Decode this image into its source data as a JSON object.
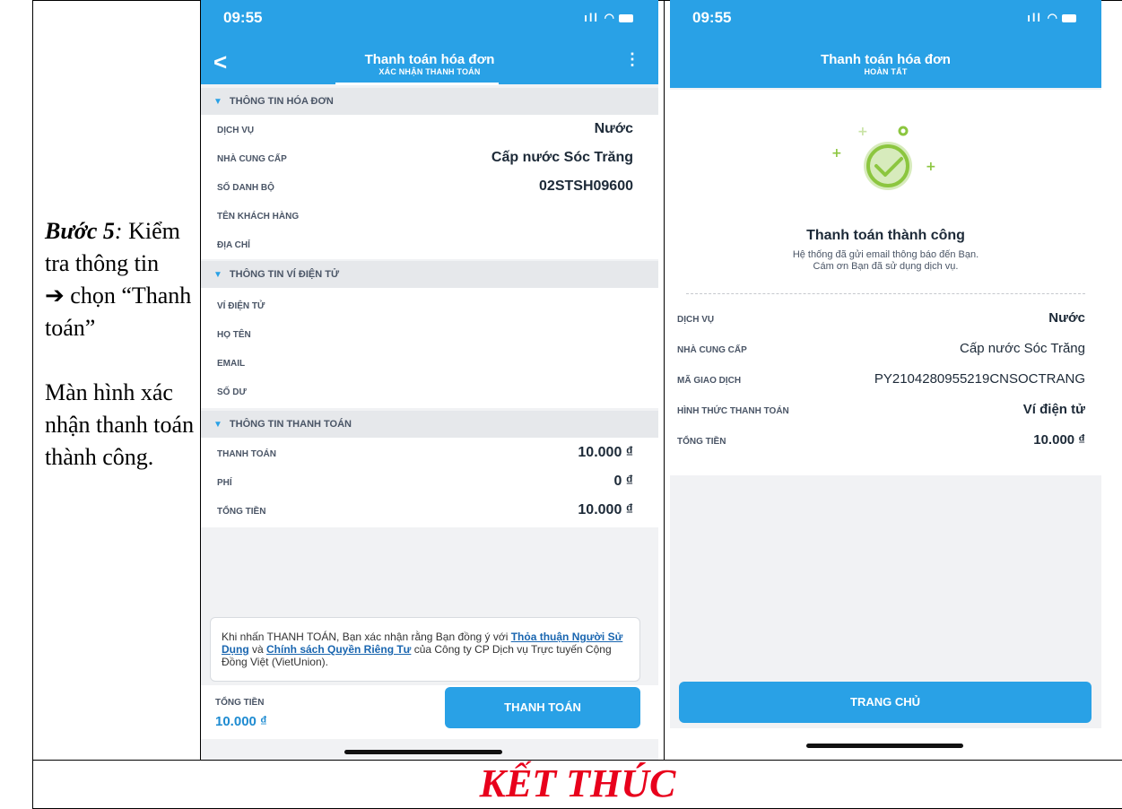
{
  "instruction": {
    "step_label": "Bước 5",
    "step_suffix": ":",
    "line1_tail": " Kiểm tra thông tin",
    "arrow": "➔",
    "line2_tail": " chọn “Thanh toán”",
    "para2": "Màn hình xác nhận thanh toán thành công."
  },
  "footer": {
    "title": "KẾT THÚC",
    "color": "#e8001c"
  },
  "phone1": {
    "time": "09:55",
    "title": "Thanh toán hóa đơn",
    "subtitle": "XÁC NHẬN THANH TOÁN",
    "sections": {
      "invoice": "THÔNG TIN HÓA ĐƠN",
      "wallet": "THÔNG TIN VÍ ĐIỆN TỬ",
      "payment": "THÔNG TIN THANH TOÁN"
    },
    "invoice_rows": [
      {
        "label": "DỊCH VỤ",
        "value": "Nước"
      },
      {
        "label": "NHÀ CUNG CẤP",
        "value": "Cấp nước Sóc Trăng"
      },
      {
        "label": "SỐ DANH BỘ",
        "value": "02STSH09600"
      },
      {
        "label": "TÊN KHÁCH HÀNG",
        "value": ""
      },
      {
        "label": "ĐỊA CHỈ",
        "value": ""
      }
    ],
    "wallet_rows": [
      {
        "label": "VÍ ĐIỆN TỬ",
        "value": ""
      },
      {
        "label": "HỌ TÊN",
        "value": ""
      },
      {
        "label": "EMAIL",
        "value": ""
      },
      {
        "label": "SỐ DƯ",
        "value": ""
      }
    ],
    "payment_rows": [
      {
        "label": "THANH TOÁN",
        "value": "10.000 ₫"
      },
      {
        "label": "PHÍ",
        "value": "0 ₫"
      },
      {
        "label": "TỔNG TIỀN",
        "value": "10.000 ₫"
      }
    ],
    "notice": {
      "part1": "Khi nhấn THANH TOÁN, Bạn xác nhận rằng Bạn đồng ý với ",
      "link1": "Thỏa thuận Người Sử Dụng",
      "part2": " và ",
      "link2": "Chính sách Quyền Riêng Tư",
      "part3": " của Công ty CP Dịch vụ Trực tuyến Cộng Đồng Việt (VietUnion)."
    },
    "total_label": "TỔNG TIỀN",
    "total_value": "10.000 ₫",
    "pay_button": "THANH TOÁN"
  },
  "phone2": {
    "time": "09:55",
    "title": "Thanh toán hóa đơn",
    "subtitle": "HOÀN TẤT",
    "success_title": "Thanh toán thành công",
    "success_line1": "Hệ thống đã gửi email thông báo đến Bạn.",
    "success_line2": "Cám ơn Bạn đã sử dụng dịch vụ.",
    "rows": [
      {
        "label": "DỊCH VỤ",
        "value": "Nước"
      },
      {
        "label": "NHÀ CUNG CẤP",
        "value": "Cấp nước Sóc Trăng"
      },
      {
        "label": "MÃ GIAO DỊCH",
        "value": "PY2104280955219CNSOCTRANG"
      },
      {
        "label": "HÌNH THỨC THANH TOÁN",
        "value": "Ví điện tử"
      },
      {
        "label": "TỔNG TIỀN",
        "value": "10.000 ₫"
      }
    ],
    "home_button": "TRANG CHỦ"
  },
  "colors": {
    "accent": "#29a1e6",
    "success": "#8cc63f"
  }
}
